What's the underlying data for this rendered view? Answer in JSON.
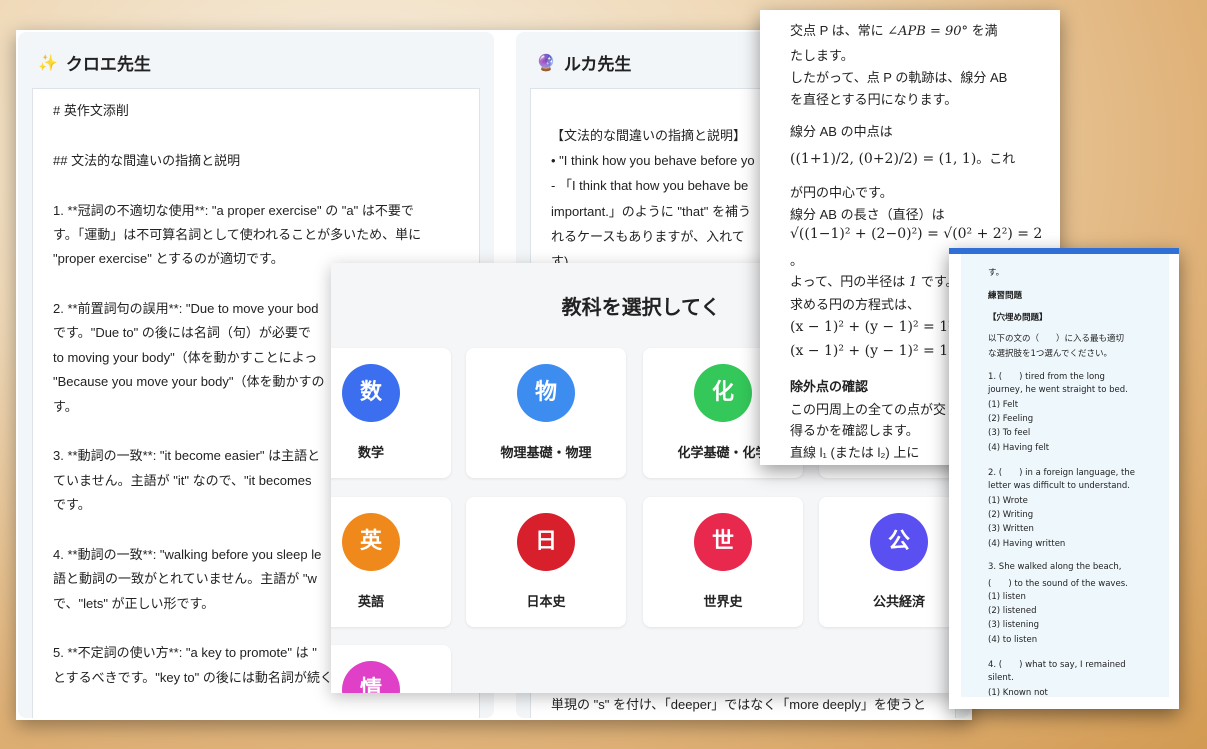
{
  "left_panel": {
    "title": "クロエ先生",
    "icon": "sparkle-icon",
    "lines": [
      "# 英作文添削",
      "## 文法的な間違いの指摘と説明",
      "1. **冠詞の不適切な使用**: \"a proper exercise\" の \"a\" は不要で",
      "す。「運動」は不可算名詞として使われることが多いため、単に",
      "\"proper exercise\" とするのが適切です。",
      "2. **前置詞句の誤用**: \"Due to move your bod",
      "です。\"Due to\" の後には名詞（句）が必要で",
      "to moving your body\"（体を動かすことによっ",
      "\"Because you move your body\"（体を動かすの",
      "す。",
      "3. **動詞の一致**: \"it become easier\" は主語と",
      "ていません。主語が \"it\" なので、\"it becomes",
      "です。",
      "4. **動詞の一致**: \"walking before you sleep le",
      "語と動詞の一致がとれていません。主語が \"w",
      "で、\"lets\" が正しい形です。",
      "5. **不定詞の使い方**: \"a key to promote\" は \"",
      "とするべきです。\"key to\" の後には動名詞が続くのが一般的で"
    ]
  },
  "right_panel": {
    "title": "ルカ先生",
    "icon": "crystal-ball-icon",
    "lines": [
      "【文法的な間違いの指摘と説明】",
      "• \"I think how you behave before yo",
      "- 「I think that how you behave be",
      "important.」のように \"that\" を補う",
      "れるケースもありますが、入れて",
      "す)"
    ],
    "bottom_line": "単現の \"s\" を付け、「deeper」ではなく「more deeply」を使うと"
  },
  "subject_modal": {
    "title": "教科を選択してく",
    "subjects": [
      {
        "glyph": "数",
        "label": "数学",
        "color": "#3b6ff0"
      },
      {
        "glyph": "物",
        "label": "物理基礎・物理",
        "color": "#3d8cf0"
      },
      {
        "glyph": "化",
        "label": "化学基礎・化学",
        "color": "#34c759"
      },
      {
        "glyph": "英",
        "label": "英語",
        "color": "#f0891c"
      },
      {
        "glyph": "日",
        "label": "日本史",
        "color": "#d81f2c"
      },
      {
        "glyph": "世",
        "label": "世界史",
        "color": "#e8284d"
      },
      {
        "glyph": "公",
        "label": "公共経済",
        "color": "#5a4ff0"
      },
      {
        "glyph": "情",
        "label": "",
        "color": "#e040c8"
      }
    ]
  },
  "math_solution": {
    "l1a": "交点 P は、常に ",
    "l1m": "∠APB = 90°",
    "l1b": " を満",
    "l2": "たします。",
    "l3": "したがって、点 P の軌跡は、線分 AB",
    "l4": "を直径とする円になります。",
    "l5": "線分 AB の中点は",
    "l6m": "((1+1)/2, (0+2)/2) = (1, 1)",
    "l6b": "。これ",
    "l7": "が円の中心です。",
    "l8": "線分 AB の長さ（直径）は",
    "l9m": "√((1−1)² + (2−0)²) = √(0² + 2²) = 2",
    "l10": "。",
    "l11a": "よって、円の半径は ",
    "l11m": "1",
    "l11b": " です。",
    "l12": "求める円の方程式は、",
    "l13m": "(x − 1)² + (y − 1)² = 1²",
    "l14m": "(x − 1)² + (y − 1)² = 1",
    "l15": "除外点の確認",
    "l16": "この円周上の全ての点が交",
    "l17": "得るかを確認します。",
    "l18": "直線 l₁ (または l₂) 上に"
  },
  "exercise": {
    "top": "す。",
    "heading": "練習問題",
    "subheading": "【穴埋め問題】",
    "intro1": "以下の文の（　　）に入る最も適切",
    "intro2": "な選択肢を1つ選んでください。",
    "q1a": "1. (　　) tired from the long",
    "q1b": "journey, he went straight to bed.",
    "q1o1": "(1) Felt",
    "q1o2": "(2) Feeling",
    "q1o3": "(3) To feel",
    "q1o4": "(4) Having felt",
    "q2a": "2. (　　) in a foreign language, the",
    "q2b": "letter was difficult to understand.",
    "q2o1": "(1) Wrote",
    "q2o2": "(2) Writing",
    "q2o3": "(3) Written",
    "q2o4": "(4) Having written",
    "q3a": "3. She walked along the beach,",
    "q3b": "(　　) to the sound of the waves.",
    "q3o1": "(1) listen",
    "q3o2": "(2) listened",
    "q3o3": "(3) listening",
    "q3o4": "(4) to listen",
    "q4a": "4. (　　) what to say, I remained",
    "q4b": "silent.",
    "q4o1": "(1) Known not"
  }
}
